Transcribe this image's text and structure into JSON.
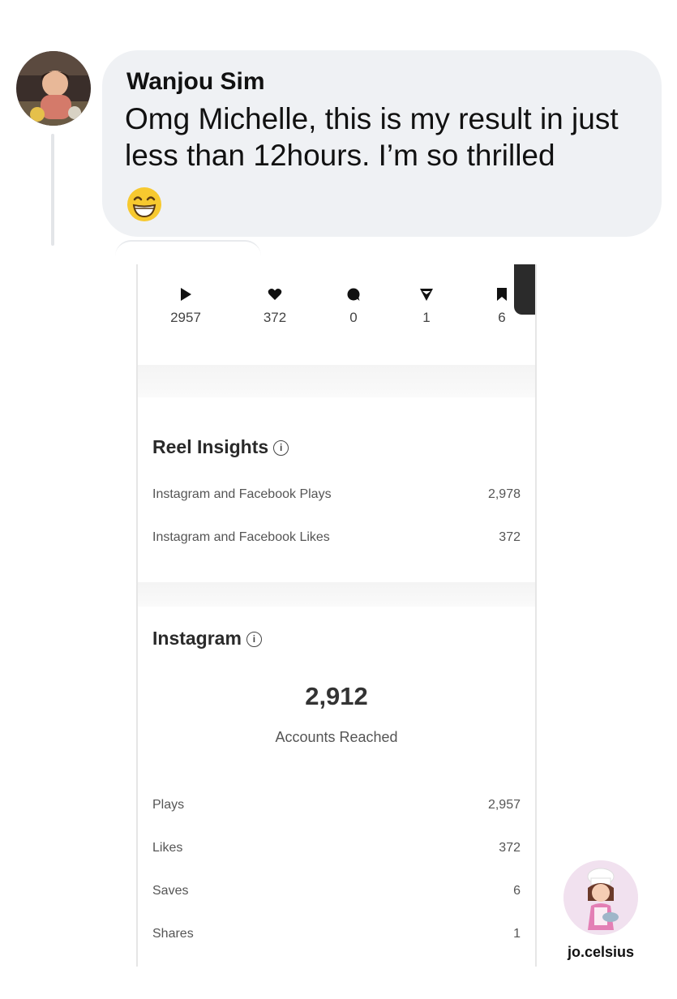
{
  "comment": {
    "author": "Wanjou Sim",
    "text": "Omg Michelle, this is my result in just less than 12hours. I’m so thrilled",
    "emoji": "grinning-face-with-smiling-eyes"
  },
  "insights": {
    "top_stats": [
      {
        "icon": "play-icon",
        "value": "2957"
      },
      {
        "icon": "heart-icon",
        "value": "372"
      },
      {
        "icon": "comment-icon",
        "value": "0"
      },
      {
        "icon": "share-icon",
        "value": "1"
      },
      {
        "icon": "bookmark-icon",
        "value": "6"
      }
    ],
    "reel_insights": {
      "title": "Reel Insights",
      "rows": [
        {
          "label": "Instagram and Facebook Plays",
          "value": "2,978"
        },
        {
          "label": "Instagram and Facebook Likes",
          "value": "372"
        }
      ]
    },
    "instagram": {
      "title": "Instagram",
      "accounts_reached": "2,912",
      "accounts_reached_label": "Accounts Reached",
      "rows": [
        {
          "label": "Plays",
          "value": "2,957"
        },
        {
          "label": "Likes",
          "value": "372"
        },
        {
          "label": "Saves",
          "value": "6"
        },
        {
          "label": "Shares",
          "value": "1"
        }
      ]
    }
  },
  "watermark": {
    "handle": "jo.celsius"
  }
}
